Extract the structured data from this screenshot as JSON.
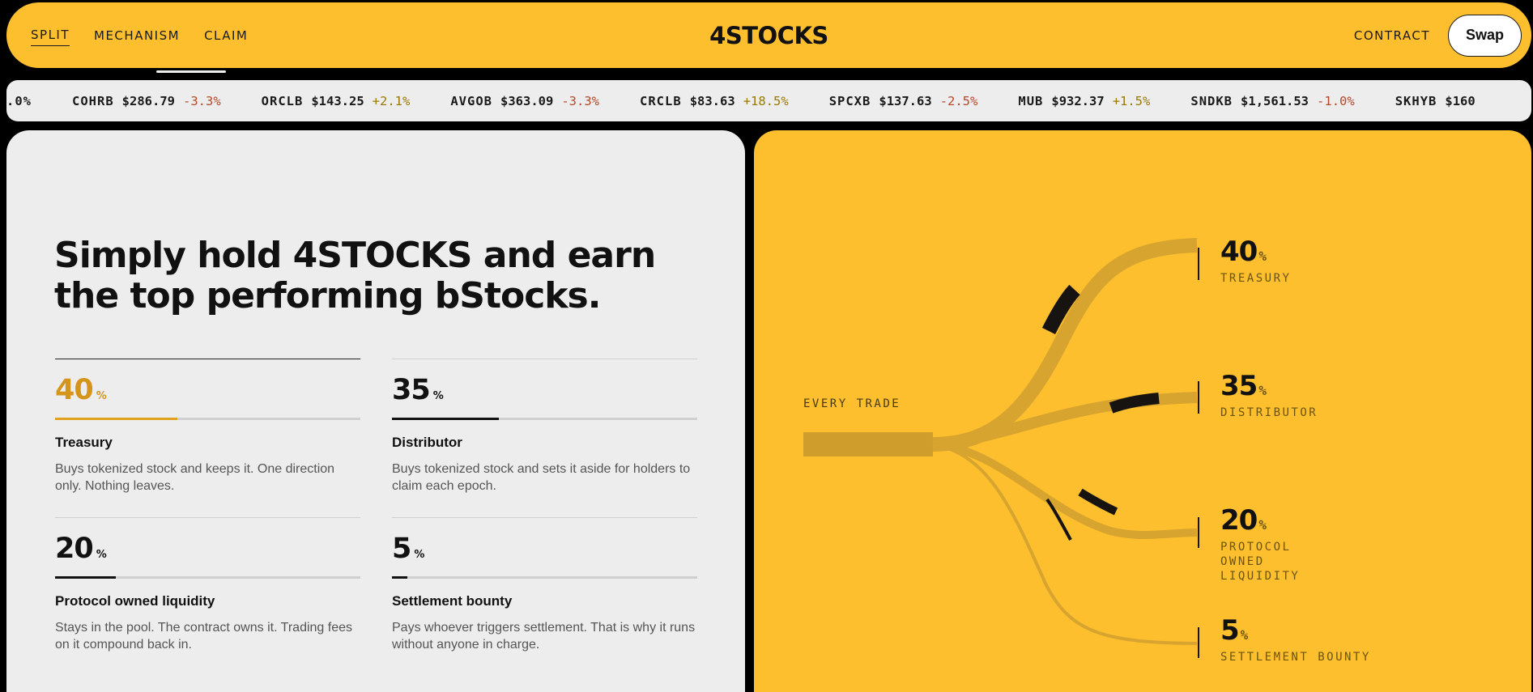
{
  "nav": {
    "links": [
      "SPLIT",
      "MECHANISM",
      "CLAIM"
    ],
    "brand": "4STOCKS",
    "contract_label": "CONTRACT",
    "swap_label": "Swap"
  },
  "ticker": [
    {
      "symbol": ".0%",
      "price": "",
      "change": "",
      "direction": "up"
    },
    {
      "symbol": "COHRB",
      "price": "$286.79",
      "change": "-3.3%",
      "direction": "down"
    },
    {
      "symbol": "ORCLB",
      "price": "$143.25",
      "change": "+2.1%",
      "direction": "up"
    },
    {
      "symbol": "AVGOB",
      "price": "$363.09",
      "change": "-3.3%",
      "direction": "down"
    },
    {
      "symbol": "CRCLB",
      "price": "$83.63",
      "change": "+18.5%",
      "direction": "up"
    },
    {
      "symbol": "SPCXB",
      "price": "$137.63",
      "change": "-2.5%",
      "direction": "down"
    },
    {
      "symbol": "MUB",
      "price": "$932.37",
      "change": "+1.5%",
      "direction": "up"
    },
    {
      "symbol": "SNDKB",
      "price": "$1,561.53",
      "change": "-1.0%",
      "direction": "down"
    },
    {
      "symbol": "SKHYB",
      "price": "$160",
      "change": "",
      "direction": "up"
    }
  ],
  "hero": {
    "headline_line1": "Simply hold 4STOCKS and earn",
    "headline_line2": "the top performing bStocks."
  },
  "stats": [
    {
      "value": "40",
      "unit": "%",
      "share": 0.4,
      "title": "Treasury",
      "desc": "Buys tokenized stock and keeps it. One direction only. Nothing leaves."
    },
    {
      "value": "35",
      "unit": "%",
      "share": 0.35,
      "title": "Distributor",
      "desc": "Buys tokenized stock and sets it aside for holders to claim each epoch."
    },
    {
      "value": "20",
      "unit": "%",
      "share": 0.2,
      "title": "Protocol owned liquidity",
      "desc": "Stays in the pool. The contract owns it. Trading fees on it compound back in."
    },
    {
      "value": "5",
      "unit": "%",
      "share": 0.05,
      "title": "Settlement bounty",
      "desc": "Pays whoever triggers settlement. That is why it runs without anyone in charge."
    }
  ],
  "flow": {
    "source_label": "EVERY TRADE",
    "targets": [
      {
        "value": "40",
        "unit": "%",
        "label": "TREASURY"
      },
      {
        "value": "35",
        "unit": "%",
        "label": "DISTRIBUTOR"
      },
      {
        "value": "20",
        "unit": "%",
        "label": "PROTOCOL OWNED LIQUIDITY"
      },
      {
        "value": "5",
        "unit": "%",
        "label": "SETTLEMENT BOUNTY"
      }
    ]
  },
  "colors": {
    "accent": "#FDBF2D",
    "treasury_highlight": "#D4951A",
    "negative": "#B5482B",
    "positive": "#9A7A00"
  }
}
